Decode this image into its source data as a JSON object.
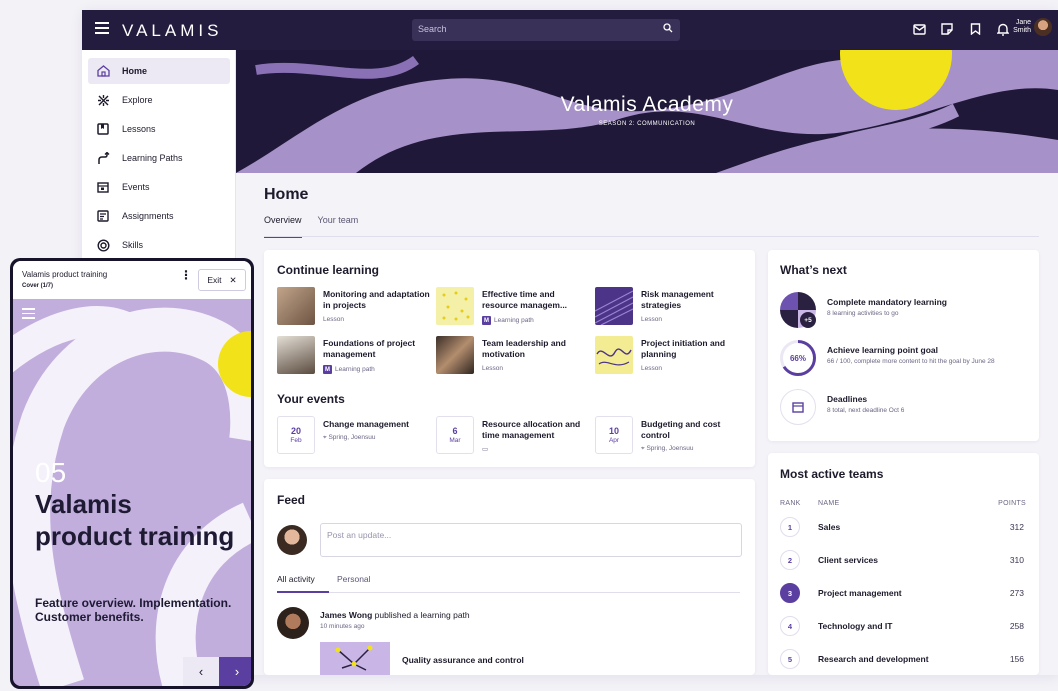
{
  "app": {
    "logo": "VALAMIS",
    "search_placeholder": "Search",
    "user": {
      "first": "Jane",
      "last": "Smith"
    }
  },
  "sidebar": {
    "items": [
      {
        "label": "Home",
        "icon": "home-icon"
      },
      {
        "label": "Explore",
        "icon": "explore-icon"
      },
      {
        "label": "Lessons",
        "icon": "lessons-icon"
      },
      {
        "label": "Learning Paths",
        "icon": "learning-paths-icon"
      },
      {
        "label": "Events",
        "icon": "calendar-icon"
      },
      {
        "label": "Assignments",
        "icon": "assignments-icon"
      },
      {
        "label": "Skills",
        "icon": "skills-icon"
      }
    ]
  },
  "banner": {
    "title": "Valamis Academy",
    "subtitle": "SEASON 2: COMMUNICATION"
  },
  "page": {
    "title": "Home",
    "tabs": [
      "Overview",
      "Your team"
    ]
  },
  "continue_learning": {
    "title": "Continue learning",
    "items": [
      {
        "name": "Monitoring and adaptation in projects",
        "type": "Lesson",
        "badge": ""
      },
      {
        "name": "Effective time and resource managem...",
        "type": "Learning path",
        "badge": "M"
      },
      {
        "name": "Risk management strategies",
        "type": "Lesson",
        "badge": ""
      },
      {
        "name": "Foundations of project management",
        "type": "Learning path",
        "badge": "M"
      },
      {
        "name": "Team leadership and motivation",
        "type": "Lesson",
        "badge": ""
      },
      {
        "name": "Project initiation and planning",
        "type": "Lesson",
        "badge": ""
      }
    ]
  },
  "events": {
    "title": "Your events",
    "items": [
      {
        "day": "20",
        "month": "Feb",
        "name": "Change management",
        "location": "Spring, Joensuu"
      },
      {
        "day": "6",
        "month": "Mar",
        "name": "Resource allocation and time management",
        "location": ""
      },
      {
        "day": "10",
        "month": "Apr",
        "name": "Budgeting and cost control",
        "location": "Spring, Joensuu"
      }
    ]
  },
  "whats_next": {
    "title": "What’s next",
    "items": [
      {
        "name": "Complete mandatory learning",
        "desc": "8 learning activities to go",
        "badge": "+5"
      },
      {
        "name": "Achieve learning point goal",
        "desc": "66 / 100, complete more content to hit the goal by June 28",
        "percent": "66%"
      },
      {
        "name": "Deadlines",
        "desc": "8 total, next deadline Oct 6"
      }
    ]
  },
  "teams": {
    "title": "Most active teams",
    "headers": {
      "rank": "RANK",
      "name": "NAME",
      "points": "POINTS"
    },
    "rows": [
      {
        "rank": "1",
        "name": "Sales",
        "points": "312"
      },
      {
        "rank": "2",
        "name": "Client services",
        "points": "310"
      },
      {
        "rank": "3",
        "name": "Project management",
        "points": "273"
      },
      {
        "rank": "4",
        "name": "Technology and IT",
        "points": "258"
      },
      {
        "rank": "5",
        "name": "Research and development",
        "points": "156"
      }
    ]
  },
  "feed": {
    "title": "Feed",
    "post_placeholder": "Post an update...",
    "tabs": [
      "All activity",
      "Personal"
    ],
    "post": {
      "author": "James Wong",
      "action": "published a learning path",
      "time": "10 minutes ago",
      "item": "Quality assurance and control"
    }
  },
  "tablet": {
    "header_title": "Valamis product training",
    "header_sub": "Cover (1/7)",
    "exit_label": "Exit",
    "number": "05",
    "title": "Valamis product training",
    "subtitle": "Feature overview. Implementation. Customer benefits."
  },
  "colors": {
    "brand_dark": "#241c3e",
    "accent": "#5b3fa0",
    "lavender": "#a691c8",
    "yellow": "#f2e21a"
  }
}
